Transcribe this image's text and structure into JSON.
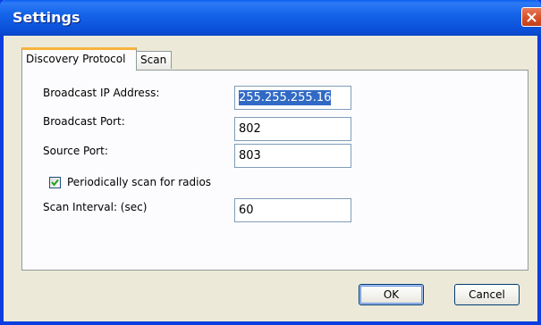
{
  "window": {
    "title": "Settings"
  },
  "tabs": [
    {
      "label": "Discovery Protocol",
      "active": true
    },
    {
      "label": "Scan",
      "active": false
    }
  ],
  "fields": {
    "broadcast_ip": {
      "label": "Broadcast IP Address:",
      "value": "255.255.255.16"
    },
    "broadcast_port": {
      "label": "Broadcast Port:",
      "value": "802"
    },
    "source_port": {
      "label": "Source Port:",
      "value": "803"
    },
    "periodic_scan": {
      "label": "Periodically scan for radios",
      "checked": true
    },
    "scan_interval": {
      "label": "Scan Interval: (sec)",
      "value": "60"
    }
  },
  "buttons": {
    "ok_label": "OK",
    "cancel_label": "Cancel"
  },
  "colors": {
    "titlebar": "#0a5cf0",
    "tab_highlight": "#f8b33c",
    "selection": "#316ac5",
    "close_button": "#d9532c"
  }
}
